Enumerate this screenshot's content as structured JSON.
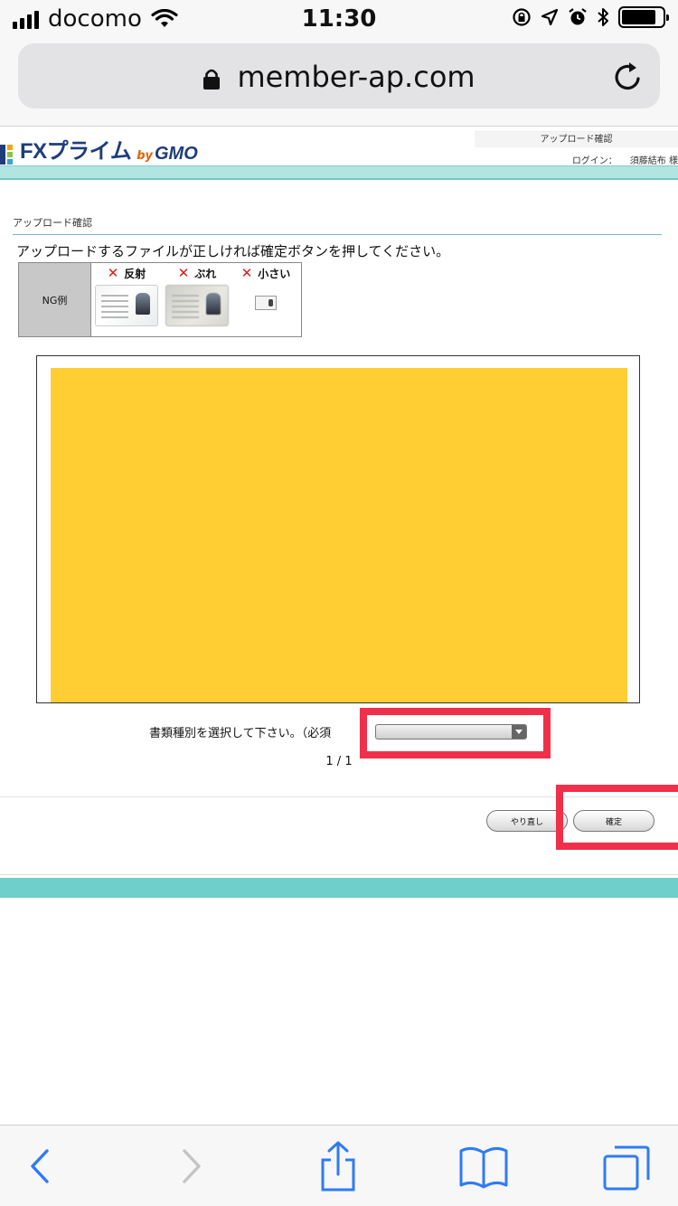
{
  "status_bar": {
    "carrier": "docomo",
    "time": "11:30",
    "battery_level": 0.85
  },
  "browser": {
    "url": "member-ap.com"
  },
  "header": {
    "logo_text": "FXプライム",
    "logo_by": "by",
    "logo_gmo": "GMO",
    "page_title": "アップロード確認",
    "login_label": "ログイン：",
    "user_name": "須藤結布 様"
  },
  "content": {
    "section_title": "アップロード確認",
    "instruction": "アップロードするファイルが正しければ確定ボタンを押してください。",
    "ng_examples": {
      "label": "NG例",
      "items": [
        {
          "mark": "✕",
          "label": "反射"
        },
        {
          "mark": "✕",
          "label": "ぶれ"
        },
        {
          "mark": "✕",
          "label": "小さい"
        }
      ]
    },
    "preview_color": "#ffce33",
    "doc_type_label": "書類種別を選択して下さい。（必須",
    "doc_type_value": "",
    "pager": "1 / 1"
  },
  "actions": {
    "redo_label": "やり直し",
    "confirm_label": "確定"
  },
  "colors": {
    "accent_teal": "#6ecfcb",
    "highlight_red": "#f0304a",
    "ios_blue": "#2f7bf5"
  }
}
